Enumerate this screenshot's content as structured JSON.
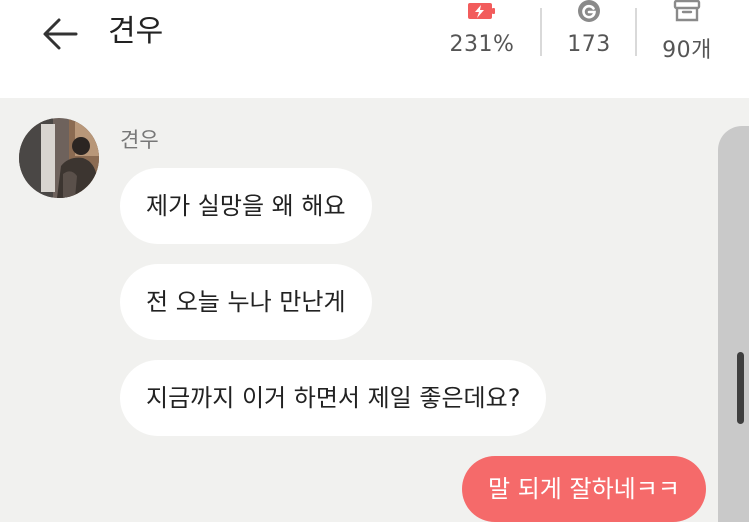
{
  "header": {
    "title": "견우",
    "stats": {
      "battery": {
        "icon": "battery-bolt-icon",
        "value": "231%",
        "color": "#f25c5c"
      },
      "coin": {
        "icon": "g-coin-icon",
        "value": "173"
      },
      "box": {
        "icon": "archive-box-icon",
        "value": "90개"
      }
    }
  },
  "chat": {
    "sender": "견우",
    "messages": [
      {
        "from": "other",
        "text": "제가 실망을 왜 해요"
      },
      {
        "from": "other",
        "text": "전 오늘 누나 만난게"
      },
      {
        "from": "other",
        "text": "지금까지 이거 하면서 제일 좋은데요?"
      },
      {
        "from": "me",
        "text": "말 되게 잘하네ㅋㅋ"
      }
    ]
  },
  "colors": {
    "accent": "#f56a6a",
    "chat_bg": "#f1f1ef",
    "bubble_other": "#ffffff"
  }
}
